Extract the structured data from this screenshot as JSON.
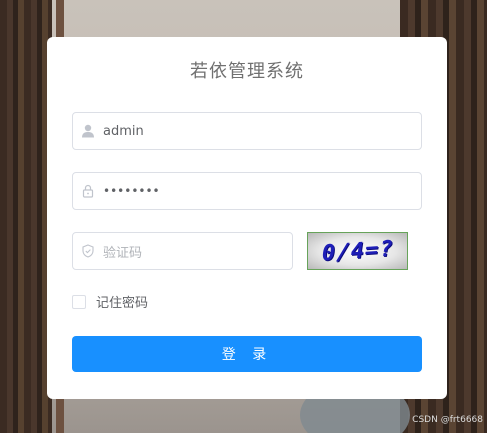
{
  "login": {
    "title": "若依管理系统",
    "username": {
      "value": "admin",
      "icon": "user-icon"
    },
    "password": {
      "value": "••••••••",
      "icon": "lock-icon"
    },
    "code": {
      "placeholder": "验证码",
      "icon": "shield-icon"
    },
    "captcha_text": "0/4=?",
    "remember_label": "记住密码",
    "submit_label": "登 录"
  },
  "watermark": "CSDN @frt6668",
  "colors": {
    "primary": "#1890ff",
    "border": "#dcdfe6"
  }
}
